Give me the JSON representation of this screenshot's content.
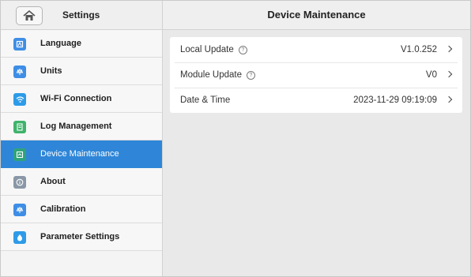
{
  "header": {
    "left_title": "Settings",
    "main_title": "Device Maintenance"
  },
  "sidebar": {
    "items": [
      {
        "label": "Language",
        "icon": "language-icon",
        "color": "#3e8ee6"
      },
      {
        "label": "Units",
        "icon": "units-icon",
        "color": "#3e8ee6"
      },
      {
        "label": "Wi-Fi Connection",
        "icon": "wifi-icon",
        "color": "#2d9be8"
      },
      {
        "label": "Log Management",
        "icon": "log-icon",
        "color": "#3fb36b"
      },
      {
        "label": "Device Maintenance",
        "icon": "maintenance-icon",
        "color": "#2fa37a",
        "active": true
      },
      {
        "label": "About",
        "icon": "about-icon",
        "color": "#8a97a6"
      },
      {
        "label": "Calibration",
        "icon": "calibration-icon",
        "color": "#3e8ee6"
      },
      {
        "label": "Parameter Settings",
        "icon": "parameter-icon",
        "color": "#2d9be8"
      }
    ]
  },
  "main": {
    "rows": [
      {
        "label": "Local Update",
        "has_info": true,
        "value": "V1.0.252"
      },
      {
        "label": "Module Update",
        "has_info": true,
        "value": "V0"
      },
      {
        "label": "Date & Time",
        "has_info": false,
        "value": "2023-11-29 09:19:09"
      }
    ]
  },
  "colors": {
    "accent": "#2f86d8"
  }
}
